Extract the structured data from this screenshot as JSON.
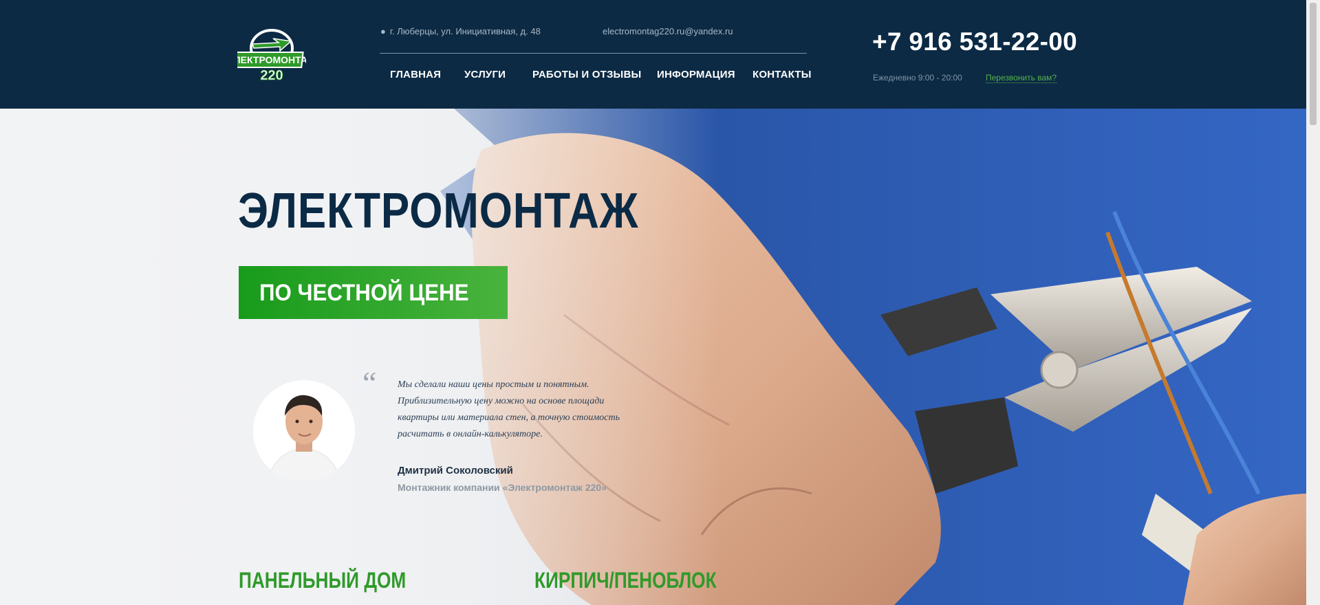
{
  "header": {
    "address": "г. Люберцы, ул. Инициативная, д. 48",
    "email": "electromontag220.ru@yandex.ru",
    "nav": [
      "ГЛАВНАЯ",
      "УСЛУГИ",
      "РАБОТЫ И ОТЗЫВЫ",
      "ИНФОРМАЦИЯ",
      "КОНТАКТЫ"
    ],
    "phone": "+7 916 531-22-00",
    "hours": "Ежедневно 9:00 - 20:00",
    "callback": "Перезвонить вам?",
    "logo_text_top": "ЭЛЕКТРОМОНТАЖ",
    "logo_text_bottom": "220"
  },
  "hero": {
    "title": "ЭЛЕКТРОМОНТАЖ",
    "badge": "ПО ЧЕСТНОЙ ЦЕНЕ",
    "quote_lines": [
      "Мы сделали наши цены простым и понятным.",
      "Приблизительную цену можно на основе площади",
      "квартиры или материала стен, а точную стоимость",
      "расчитать в онлайн-калькуляторе."
    ],
    "author_name": "Дмитрий Соколовский",
    "author_role": "Монтажник компании «Электромонтаж 220»",
    "categories": [
      {
        "title": "ПАНЕЛЬНЫЙ ДОМ",
        "price": ""
      },
      {
        "title": "КИРПИЧ/ПЕНОБЛОК",
        "price": ""
      }
    ]
  },
  "colors": {
    "header_bg": "#0c2a44",
    "accent_green": "#2f9a2a",
    "title_navy": "#0b2a45"
  }
}
